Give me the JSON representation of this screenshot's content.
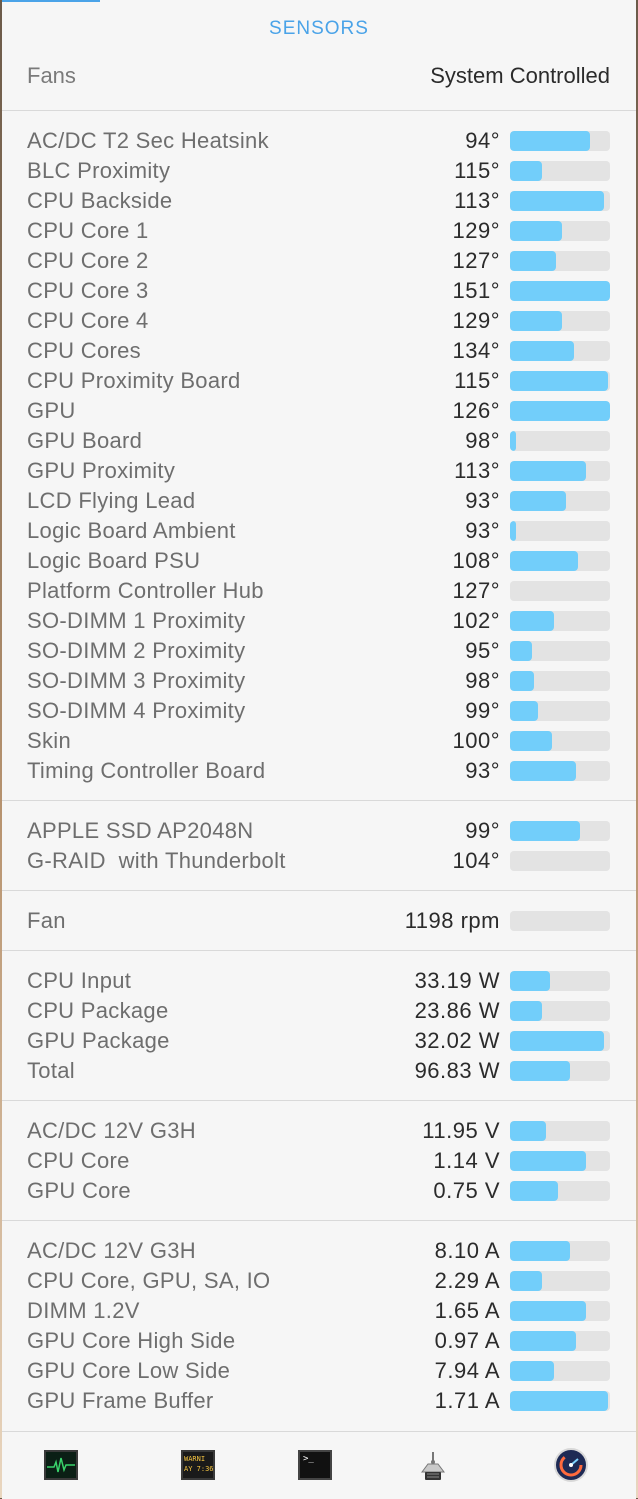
{
  "header": {
    "title": "SENSORS"
  },
  "fans_mode": {
    "label": "Fans",
    "value": "System Controlled"
  },
  "temperatures": [
    {
      "label": "AC/DC T2 Sec Heatsink",
      "value": "94°",
      "level": 0.8
    },
    {
      "label": "BLC Proximity",
      "value": "115°",
      "level": 0.32
    },
    {
      "label": "CPU Backside",
      "value": "113°",
      "level": 0.94
    },
    {
      "label": "CPU Core 1",
      "value": "129°",
      "level": 0.52
    },
    {
      "label": "CPU Core 2",
      "value": "127°",
      "level": 0.46
    },
    {
      "label": "CPU Core 3",
      "value": "151°",
      "level": 1.0
    },
    {
      "label": "CPU Core 4",
      "value": "129°",
      "level": 0.52
    },
    {
      "label": "CPU Cores",
      "value": "134°",
      "level": 0.64
    },
    {
      "label": "CPU Proximity Board",
      "value": "115°",
      "level": 0.98
    },
    {
      "label": "GPU",
      "value": "126°",
      "level": 1.0
    },
    {
      "label": "GPU Board",
      "value": "98°",
      "level": 0.06
    },
    {
      "label": "GPU Proximity",
      "value": "113°",
      "level": 0.76
    },
    {
      "label": "LCD Flying Lead",
      "value": "93°",
      "level": 0.56
    },
    {
      "label": "Logic Board Ambient",
      "value": "93°",
      "level": 0.06
    },
    {
      "label": "Logic Board PSU",
      "value": "108°",
      "level": 0.68
    },
    {
      "label": "Platform Controller Hub",
      "value": "127°",
      "level": 0.0
    },
    {
      "label": "SO-DIMM 1 Proximity",
      "value": "102°",
      "level": 0.44
    },
    {
      "label": "SO-DIMM 2 Proximity",
      "value": "95°",
      "level": 0.22
    },
    {
      "label": "SO-DIMM 3 Proximity",
      "value": "98°",
      "level": 0.24
    },
    {
      "label": "SO-DIMM 4 Proximity",
      "value": "99°",
      "level": 0.28
    },
    {
      "label": "Skin",
      "value": "100°",
      "level": 0.42
    },
    {
      "label": "Timing Controller Board",
      "value": "93°",
      "level": 0.66
    }
  ],
  "drives": [
    {
      "label": "APPLE SSD AP2048N",
      "value": "99°",
      "level": 0.7
    },
    {
      "label": "G-RAID  with Thunderbolt",
      "value": "104°",
      "level": 0.0
    }
  ],
  "fans": [
    {
      "label": "Fan",
      "value": "1198 rpm",
      "level": 0.0
    }
  ],
  "power": [
    {
      "label": "CPU Input",
      "value": "33.19 W",
      "level": 0.4
    },
    {
      "label": "CPU Package",
      "value": "23.86 W",
      "level": 0.32
    },
    {
      "label": "GPU Package",
      "value": "32.02 W",
      "level": 0.94
    },
    {
      "label": "Total",
      "value": "96.83 W",
      "level": 0.6
    }
  ],
  "voltage": [
    {
      "label": "AC/DC 12V G3H",
      "value": "11.95 V",
      "level": 0.36
    },
    {
      "label": "CPU Core",
      "value": "1.14 V",
      "level": 0.76
    },
    {
      "label": "GPU Core",
      "value": "0.75 V",
      "level": 0.48
    }
  ],
  "current": [
    {
      "label": "AC/DC 12V G3H",
      "value": "8.10 A",
      "level": 0.6
    },
    {
      "label": "CPU Core, GPU, SA, IO",
      "value": "2.29 A",
      "level": 0.32
    },
    {
      "label": "DIMM 1.2V",
      "value": "1.65 A",
      "level": 0.76
    },
    {
      "label": "GPU Core High Side",
      "value": "0.97 A",
      "level": 0.66
    },
    {
      "label": "GPU Core Low Side",
      "value": "7.94 A",
      "level": 0.44
    },
    {
      "label": "GPU Frame Buffer",
      "value": "1.71 A",
      "level": 0.98
    }
  ],
  "toolbar": {
    "items": [
      {
        "name": "activity-monitor-icon"
      },
      {
        "name": "console-icon",
        "text": "WARNI\nAY 7:36"
      },
      {
        "name": "terminal-icon",
        "text": ">_"
      },
      {
        "name": "system-utility-icon"
      },
      {
        "name": "istat-menus-icon"
      }
    ]
  },
  "colors": {
    "accent": "#4aa3e8",
    "bar_fill": "#72cefa",
    "bar_track": "#e3e3e3"
  }
}
